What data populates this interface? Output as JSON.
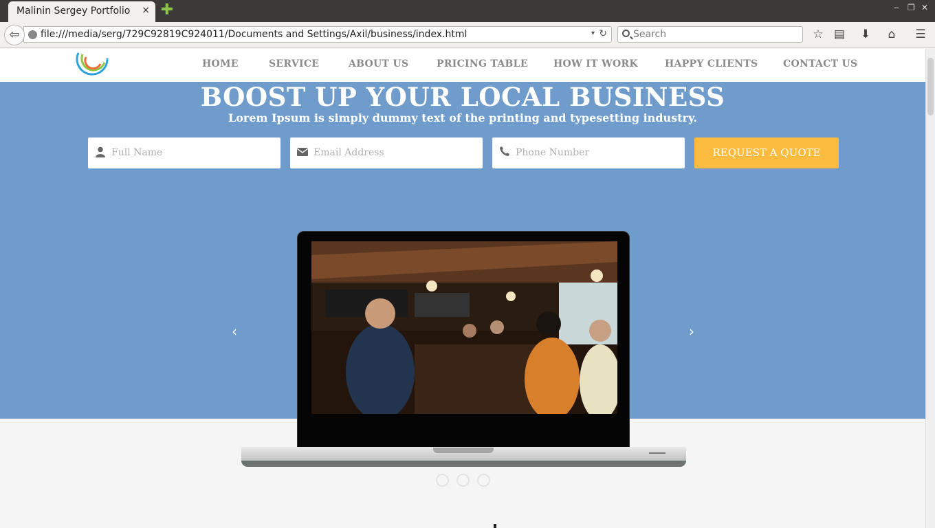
{
  "browser": {
    "tab_title": "Malinin Sergey Portfolio",
    "tab_close": "×",
    "new_tab": "✚",
    "back": "⇦",
    "url": "file:///media/serg/729C92819C924011/Documents and Settings/Axil/business/index.html",
    "url_dropdown": "▾",
    "reload": "↻",
    "search_placeholder": "Search",
    "window_controls": [
      "‒",
      "❐",
      "✕"
    ],
    "toolbar_icons": [
      "bookmark-star-icon",
      "reading-list-icon",
      "download-icon",
      "home-icon",
      "menu-icon"
    ]
  },
  "nav": {
    "items": [
      "HOME",
      "SERVICE",
      "ABOUT US",
      "PRICING TABLE",
      "HOW IT WORK",
      "HAPPY CLIENTS",
      "CONTACT US"
    ]
  },
  "hero": {
    "title": "BOOST UP YOUR LOCAL BUSINESS",
    "subtitle": "Lorem Ipsum is simply dummy text of the printing and typesetting industry.",
    "form": {
      "name_placeholder": "Full Name",
      "email_placeholder": "Email Address",
      "phone_placeholder": "Phone Number",
      "submit_label": "REQUEST A QUOTE"
    },
    "prev_arrow": "‹",
    "next_arrow": "›",
    "slides_count": 3
  },
  "colors": {
    "hero_bg": "#6f9ccb",
    "button": "#fbbb3f",
    "nav_text": "#8a8a8a"
  }
}
